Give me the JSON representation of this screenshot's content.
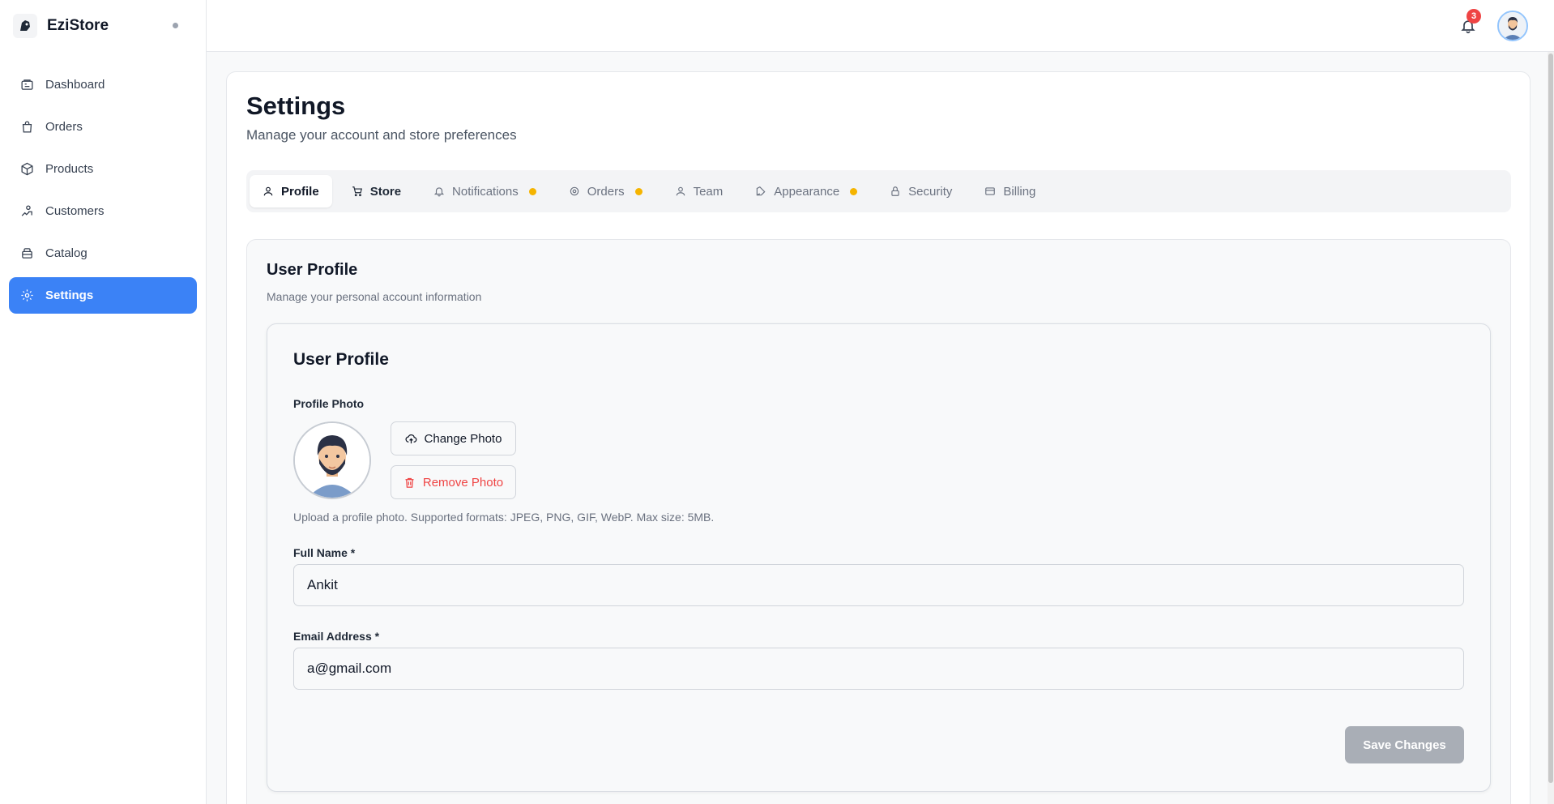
{
  "app": {
    "name": "EziStore"
  },
  "sidebar": {
    "items": [
      {
        "label": "Dashboard",
        "icon": "dashboard-icon"
      },
      {
        "label": "Orders",
        "icon": "shopping-bag-icon"
      },
      {
        "label": "Products",
        "icon": "box-icon"
      },
      {
        "label": "Customers",
        "icon": "customers-icon"
      },
      {
        "label": "Catalog",
        "icon": "catalog-icon"
      },
      {
        "label": "Settings",
        "icon": "gear-icon",
        "active": true
      }
    ]
  },
  "header": {
    "notifications_count": "3"
  },
  "page": {
    "title": "Settings",
    "subtitle": "Manage your account and store preferences"
  },
  "tabs": [
    {
      "label": "Profile",
      "icon": "user-icon",
      "active": true
    },
    {
      "label": "Store",
      "icon": "cart-icon"
    },
    {
      "label": "Notifications",
      "icon": "bell-icon",
      "pending": true
    },
    {
      "label": "Orders",
      "icon": "gear-icon",
      "pending": true
    },
    {
      "label": "Team",
      "icon": "team-icon"
    },
    {
      "label": "Appearance",
      "icon": "palette-icon",
      "pending": true
    },
    {
      "label": "Security",
      "icon": "lock-icon"
    },
    {
      "label": "Billing",
      "icon": "credit-card-icon"
    }
  ],
  "profile_section": {
    "title": "User Profile",
    "description": "Manage your personal account information",
    "card_title": "User Profile",
    "photo_label": "Profile Photo",
    "change_photo": "Change Photo",
    "remove_photo": "Remove Photo",
    "photo_help": "Upload a profile photo. Supported formats: JPEG, PNG, GIF, WebP. Max size: 5MB.",
    "full_name_label": "Full Name *",
    "full_name_value": "Ankit",
    "email_label": "Email Address *",
    "email_value": "a@gmail.com",
    "save_label": "Save Changes"
  },
  "colors": {
    "accent": "#3b82f6",
    "badge": "#ef4444",
    "pending_dot": "#f5b400",
    "danger": "#ef4444",
    "disabled_button": "#a9aeb6"
  }
}
